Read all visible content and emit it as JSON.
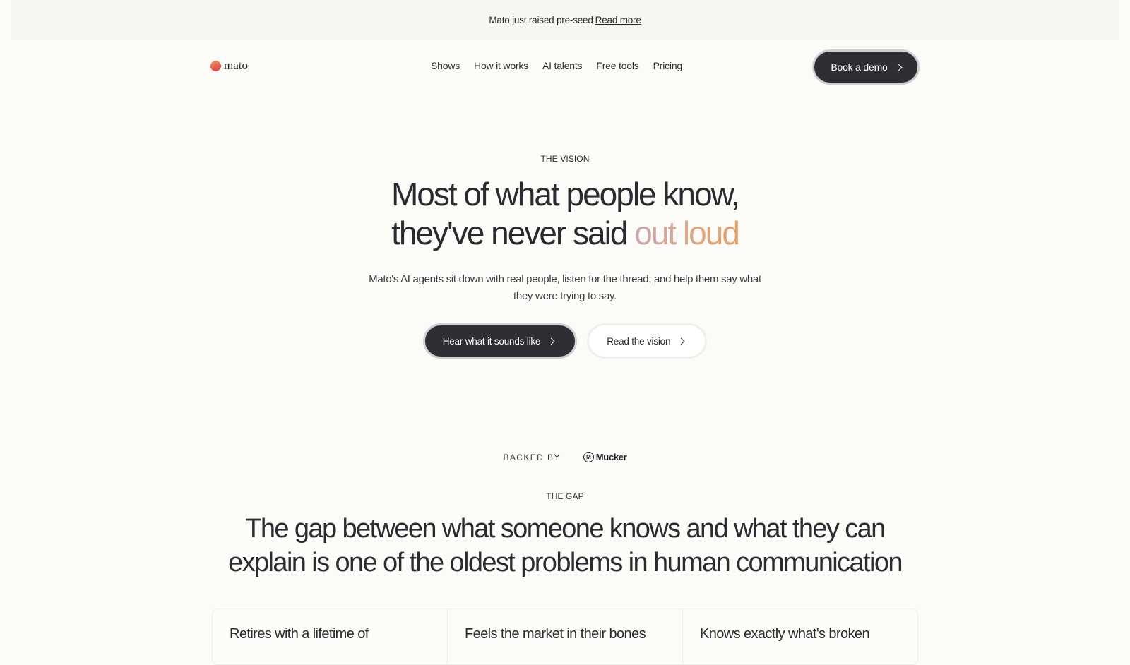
{
  "announcement": {
    "text": "Mato just raised pre-seed",
    "link": "Read more"
  },
  "nav": {
    "logo": "mato",
    "items": [
      "Shows",
      "How it works",
      "AI talents",
      "Free tools",
      "Pricing"
    ],
    "cta": "Book a demo"
  },
  "hero": {
    "eyebrow": "THE VISION",
    "title_line1": "Most of what people know,",
    "title_line2_plain": "they've never said ",
    "title_line2_accent": "out loud",
    "subtitle": "Mato's AI agents sit down with real people, listen for the thread, and help them say what they were trying to say.",
    "primary_cta": "Hear what it sounds like",
    "secondary_cta": "Read the vision"
  },
  "backed": {
    "label": "BACKED BY",
    "investor": "Mucker",
    "investor_mark": "M"
  },
  "gap": {
    "eyebrow": "THE GAP",
    "title": "The gap between what someone knows and what they can explain is one of the oldest problems in human communication",
    "cards": [
      "Retires with a lifetime of",
      "Feels the market in their bones",
      "Knows exactly what's broken"
    ]
  },
  "colors": {
    "accent_dark": "#2e2f35",
    "background": "#fcfbf7",
    "logo_orange": "#e2604c",
    "gradient_end": "#e2a068"
  }
}
